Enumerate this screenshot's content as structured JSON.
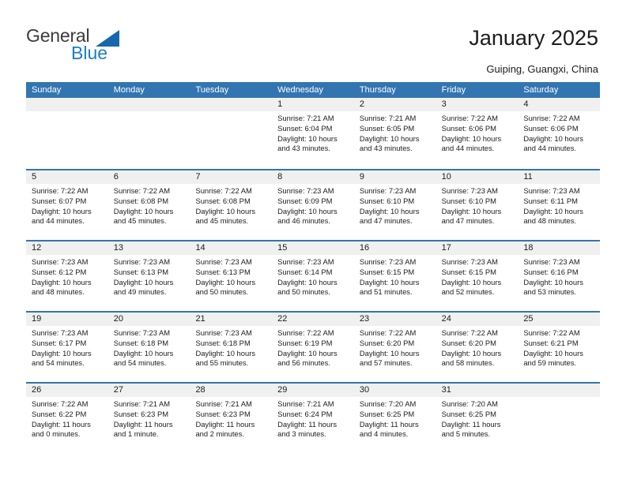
{
  "brand": {
    "name_part1": "General",
    "name_part2": "Blue",
    "triangle_color": "#1667ad",
    "blue_color": "#1a7fc1",
    "gray_color": "#3b3b3b"
  },
  "header": {
    "title": "January 2025",
    "subtitle": "Guiping, Guangxi, China",
    "header_bar_color": "#3275b1",
    "daynum_band_color": "#f0f0f0"
  },
  "weekdays": [
    "Sunday",
    "Monday",
    "Tuesday",
    "Wednesday",
    "Thursday",
    "Friday",
    "Saturday"
  ],
  "labels": {
    "sunrise_prefix": "Sunrise:",
    "sunset_prefix": "Sunset:",
    "daylight_prefix": "Daylight:"
  },
  "weeks": [
    [
      {
        "day": "",
        "empty": true,
        "sunrise": "",
        "sunset": "",
        "daylight_line1": "",
        "daylight_line2": ""
      },
      {
        "day": "",
        "empty": true,
        "sunrise": "",
        "sunset": "",
        "daylight_line1": "",
        "daylight_line2": ""
      },
      {
        "day": "",
        "empty": true,
        "sunrise": "",
        "sunset": "",
        "daylight_line1": "",
        "daylight_line2": ""
      },
      {
        "day": "1",
        "empty": false,
        "sunrise": "Sunrise: 7:21 AM",
        "sunset": "Sunset: 6:04 PM",
        "daylight_line1": "Daylight: 10 hours",
        "daylight_line2": "and 43 minutes."
      },
      {
        "day": "2",
        "empty": false,
        "sunrise": "Sunrise: 7:21 AM",
        "sunset": "Sunset: 6:05 PM",
        "daylight_line1": "Daylight: 10 hours",
        "daylight_line2": "and 43 minutes."
      },
      {
        "day": "3",
        "empty": false,
        "sunrise": "Sunrise: 7:22 AM",
        "sunset": "Sunset: 6:06 PM",
        "daylight_line1": "Daylight: 10 hours",
        "daylight_line2": "and 44 minutes."
      },
      {
        "day": "4",
        "empty": false,
        "sunrise": "Sunrise: 7:22 AM",
        "sunset": "Sunset: 6:06 PM",
        "daylight_line1": "Daylight: 10 hours",
        "daylight_line2": "and 44 minutes."
      }
    ],
    [
      {
        "day": "5",
        "empty": false,
        "sunrise": "Sunrise: 7:22 AM",
        "sunset": "Sunset: 6:07 PM",
        "daylight_line1": "Daylight: 10 hours",
        "daylight_line2": "and 44 minutes."
      },
      {
        "day": "6",
        "empty": false,
        "sunrise": "Sunrise: 7:22 AM",
        "sunset": "Sunset: 6:08 PM",
        "daylight_line1": "Daylight: 10 hours",
        "daylight_line2": "and 45 minutes."
      },
      {
        "day": "7",
        "empty": false,
        "sunrise": "Sunrise: 7:22 AM",
        "sunset": "Sunset: 6:08 PM",
        "daylight_line1": "Daylight: 10 hours",
        "daylight_line2": "and 45 minutes."
      },
      {
        "day": "8",
        "empty": false,
        "sunrise": "Sunrise: 7:23 AM",
        "sunset": "Sunset: 6:09 PM",
        "daylight_line1": "Daylight: 10 hours",
        "daylight_line2": "and 46 minutes."
      },
      {
        "day": "9",
        "empty": false,
        "sunrise": "Sunrise: 7:23 AM",
        "sunset": "Sunset: 6:10 PM",
        "daylight_line1": "Daylight: 10 hours",
        "daylight_line2": "and 47 minutes."
      },
      {
        "day": "10",
        "empty": false,
        "sunrise": "Sunrise: 7:23 AM",
        "sunset": "Sunset: 6:10 PM",
        "daylight_line1": "Daylight: 10 hours",
        "daylight_line2": "and 47 minutes."
      },
      {
        "day": "11",
        "empty": false,
        "sunrise": "Sunrise: 7:23 AM",
        "sunset": "Sunset: 6:11 PM",
        "daylight_line1": "Daylight: 10 hours",
        "daylight_line2": "and 48 minutes."
      }
    ],
    [
      {
        "day": "12",
        "empty": false,
        "sunrise": "Sunrise: 7:23 AM",
        "sunset": "Sunset: 6:12 PM",
        "daylight_line1": "Daylight: 10 hours",
        "daylight_line2": "and 48 minutes."
      },
      {
        "day": "13",
        "empty": false,
        "sunrise": "Sunrise: 7:23 AM",
        "sunset": "Sunset: 6:13 PM",
        "daylight_line1": "Daylight: 10 hours",
        "daylight_line2": "and 49 minutes."
      },
      {
        "day": "14",
        "empty": false,
        "sunrise": "Sunrise: 7:23 AM",
        "sunset": "Sunset: 6:13 PM",
        "daylight_line1": "Daylight: 10 hours",
        "daylight_line2": "and 50 minutes."
      },
      {
        "day": "15",
        "empty": false,
        "sunrise": "Sunrise: 7:23 AM",
        "sunset": "Sunset: 6:14 PM",
        "daylight_line1": "Daylight: 10 hours",
        "daylight_line2": "and 50 minutes."
      },
      {
        "day": "16",
        "empty": false,
        "sunrise": "Sunrise: 7:23 AM",
        "sunset": "Sunset: 6:15 PM",
        "daylight_line1": "Daylight: 10 hours",
        "daylight_line2": "and 51 minutes."
      },
      {
        "day": "17",
        "empty": false,
        "sunrise": "Sunrise: 7:23 AM",
        "sunset": "Sunset: 6:15 PM",
        "daylight_line1": "Daylight: 10 hours",
        "daylight_line2": "and 52 minutes."
      },
      {
        "day": "18",
        "empty": false,
        "sunrise": "Sunrise: 7:23 AM",
        "sunset": "Sunset: 6:16 PM",
        "daylight_line1": "Daylight: 10 hours",
        "daylight_line2": "and 53 minutes."
      }
    ],
    [
      {
        "day": "19",
        "empty": false,
        "sunrise": "Sunrise: 7:23 AM",
        "sunset": "Sunset: 6:17 PM",
        "daylight_line1": "Daylight: 10 hours",
        "daylight_line2": "and 54 minutes."
      },
      {
        "day": "20",
        "empty": false,
        "sunrise": "Sunrise: 7:23 AM",
        "sunset": "Sunset: 6:18 PM",
        "daylight_line1": "Daylight: 10 hours",
        "daylight_line2": "and 54 minutes."
      },
      {
        "day": "21",
        "empty": false,
        "sunrise": "Sunrise: 7:23 AM",
        "sunset": "Sunset: 6:18 PM",
        "daylight_line1": "Daylight: 10 hours",
        "daylight_line2": "and 55 minutes."
      },
      {
        "day": "22",
        "empty": false,
        "sunrise": "Sunrise: 7:22 AM",
        "sunset": "Sunset: 6:19 PM",
        "daylight_line1": "Daylight: 10 hours",
        "daylight_line2": "and 56 minutes."
      },
      {
        "day": "23",
        "empty": false,
        "sunrise": "Sunrise: 7:22 AM",
        "sunset": "Sunset: 6:20 PM",
        "daylight_line1": "Daylight: 10 hours",
        "daylight_line2": "and 57 minutes."
      },
      {
        "day": "24",
        "empty": false,
        "sunrise": "Sunrise: 7:22 AM",
        "sunset": "Sunset: 6:20 PM",
        "daylight_line1": "Daylight: 10 hours",
        "daylight_line2": "and 58 minutes."
      },
      {
        "day": "25",
        "empty": false,
        "sunrise": "Sunrise: 7:22 AM",
        "sunset": "Sunset: 6:21 PM",
        "daylight_line1": "Daylight: 10 hours",
        "daylight_line2": "and 59 minutes."
      }
    ],
    [
      {
        "day": "26",
        "empty": false,
        "sunrise": "Sunrise: 7:22 AM",
        "sunset": "Sunset: 6:22 PM",
        "daylight_line1": "Daylight: 11 hours",
        "daylight_line2": "and 0 minutes."
      },
      {
        "day": "27",
        "empty": false,
        "sunrise": "Sunrise: 7:21 AM",
        "sunset": "Sunset: 6:23 PM",
        "daylight_line1": "Daylight: 11 hours",
        "daylight_line2": "and 1 minute."
      },
      {
        "day": "28",
        "empty": false,
        "sunrise": "Sunrise: 7:21 AM",
        "sunset": "Sunset: 6:23 PM",
        "daylight_line1": "Daylight: 11 hours",
        "daylight_line2": "and 2 minutes."
      },
      {
        "day": "29",
        "empty": false,
        "sunrise": "Sunrise: 7:21 AM",
        "sunset": "Sunset: 6:24 PM",
        "daylight_line1": "Daylight: 11 hours",
        "daylight_line2": "and 3 minutes."
      },
      {
        "day": "30",
        "empty": false,
        "sunrise": "Sunrise: 7:20 AM",
        "sunset": "Sunset: 6:25 PM",
        "daylight_line1": "Daylight: 11 hours",
        "daylight_line2": "and 4 minutes."
      },
      {
        "day": "31",
        "empty": false,
        "sunrise": "Sunrise: 7:20 AM",
        "sunset": "Sunset: 6:25 PM",
        "daylight_line1": "Daylight: 11 hours",
        "daylight_line2": "and 5 minutes."
      },
      {
        "day": "",
        "empty": true,
        "sunrise": "",
        "sunset": "",
        "daylight_line1": "",
        "daylight_line2": ""
      }
    ]
  ]
}
